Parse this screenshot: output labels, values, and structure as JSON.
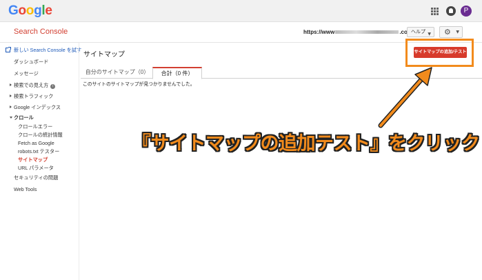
{
  "google": {
    "logo_letters": [
      "G",
      "o",
      "o",
      "g",
      "l",
      "e"
    ]
  },
  "topbar": {
    "avatar_letter": "P",
    "icons": [
      "apps-grid-icon",
      "notifications-icon"
    ]
  },
  "header": {
    "title": "Search Console",
    "site_prefix": "https://www",
    "site_suffix": ".com/",
    "help_label": "ヘルプ",
    "settings_icon": "gear-icon"
  },
  "sidebar": {
    "new_console_link": "新しい Search Console を試す",
    "dashboard": "ダッシュボード",
    "messages": "メッセージ",
    "search_appearance": "検索での見え方",
    "search_traffic": "検索トラフィック",
    "google_index": "Google インデックス",
    "crawl": "クロール",
    "crawl_items": [
      "クロールエラー",
      "クロールの統計情報",
      "Fetch as Google",
      "robots.txt テスター",
      "サイトマップ",
      "URL パラメータ"
    ],
    "security": "セキュリティの問題",
    "web_tools": "Web Tools"
  },
  "main": {
    "title": "サイトマップ",
    "add_button": "サイトマップの追加/テスト",
    "tabs": [
      {
        "label": "自分のサイトマップ（0）"
      },
      {
        "label": "合計（0 件）"
      }
    ],
    "empty_message": "このサイトのサイトマップが見つかりませんでした。"
  },
  "annotation": {
    "text": "『サイトマップの追加テスト』をクリック",
    "color": "#f28b1c"
  },
  "colors": {
    "brand_red": "#d23f31",
    "button_red": "#d73a2b",
    "link_blue": "#1a57b8"
  }
}
